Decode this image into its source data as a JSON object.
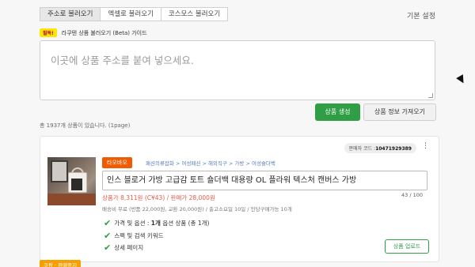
{
  "tabs": [
    {
      "label": "주소로 불러오기",
      "active": true
    },
    {
      "label": "엑셀로 불러오기",
      "active": false
    },
    {
      "label": "코스모스 불러오기",
      "active": false
    }
  ],
  "basic_settings_label": "기본 설정",
  "guide": {
    "badge": "필독!",
    "text": "라쿠텐 상품 불러오기 (Beta) 가이드"
  },
  "url_input": {
    "placeholder": "이곳에 상품 주소를 붙여 넣으세요."
  },
  "buttons": {
    "create": "상품 생성",
    "fetch": "상품 정보 가져오기"
  },
  "count_text": "총 1937개 상품이 있습니다. (1page)",
  "product": {
    "seller_code_label": "판매자 코드 :",
    "seller_code": "10471929389",
    "shop": "타오바오",
    "category": "패션의류잡화 > 여성패션 > 해외직구 > 가방 > 여성숄더백",
    "title": "인스 블로거 가방  고급감 토트 숄더백 대용량 OL 플라워 텍스처 캔버스 가방",
    "title_count": "43 / 100",
    "price": "상품가 8,311원 (C¥43) / 판매가 28,000원",
    "shipping": "배송비 무료 (반품 22,000원, 교환 20,000원) / 출고소요일 10일 / 인당구매가능 10개",
    "checks": [
      {
        "prefix": "가격 및 옵션 :",
        "bold": "1개",
        "suffix": "옵션 상품 (총 1개)"
      },
      {
        "text": "스펙 및 검색 키워드"
      },
      {
        "text": "상세 페이지"
      }
    ],
    "upload_label": "상품 업로드"
  },
  "status_badge": "쿠팡 · 판매중지",
  "colors": {
    "accent_green": "#2f9e44",
    "shop_orange": "#f05a00",
    "price_red": "#e8584a"
  }
}
